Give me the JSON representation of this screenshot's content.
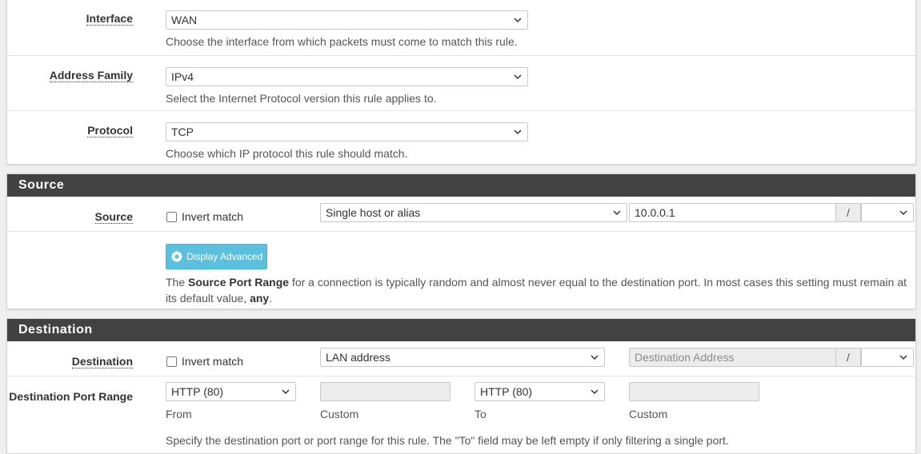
{
  "general": {
    "interface": {
      "label": "Interface",
      "value": "WAN",
      "help": "Choose the interface from which packets must come to match this rule."
    },
    "address_family": {
      "label": "Address Family",
      "value": "IPv4",
      "help": "Select the Internet Protocol version this rule applies to."
    },
    "protocol": {
      "label": "Protocol",
      "value": "TCP",
      "help": "Choose which IP protocol this rule should match."
    }
  },
  "source": {
    "title": "Source",
    "label": "Source",
    "invert_label": "Invert match",
    "type_value": "Single host or alias",
    "address_value": "10.0.0.1",
    "slash": "/",
    "mask_value": "",
    "advanced_button": "Display Advanced",
    "help_pre": "The ",
    "help_bold": "Source Port Range",
    "help_mid": " for a connection is typically random and almost never equal to the destination port. In most cases this setting must remain at its default value, ",
    "help_bold2": "any",
    "help_post": "."
  },
  "destination": {
    "title": "Destination",
    "label": "Destination",
    "invert_label": "Invert match",
    "type_value": "LAN address",
    "address_placeholder": "Destination Address",
    "slash": "/",
    "mask_value": "",
    "port_range_label": "Destination Port Range",
    "from_value": "HTTP (80)",
    "from_label": "From",
    "custom_from": "",
    "custom_label": "Custom",
    "to_value": "HTTP (80)",
    "to_label": "To",
    "custom_to": "",
    "custom_label2": "Custom",
    "help": "Specify the destination port or port range for this rule. The \"To\" field may be left empty if only filtering a single port."
  },
  "icons": {
    "chevron": "chevron-down-icon",
    "gear": "gear-icon"
  }
}
